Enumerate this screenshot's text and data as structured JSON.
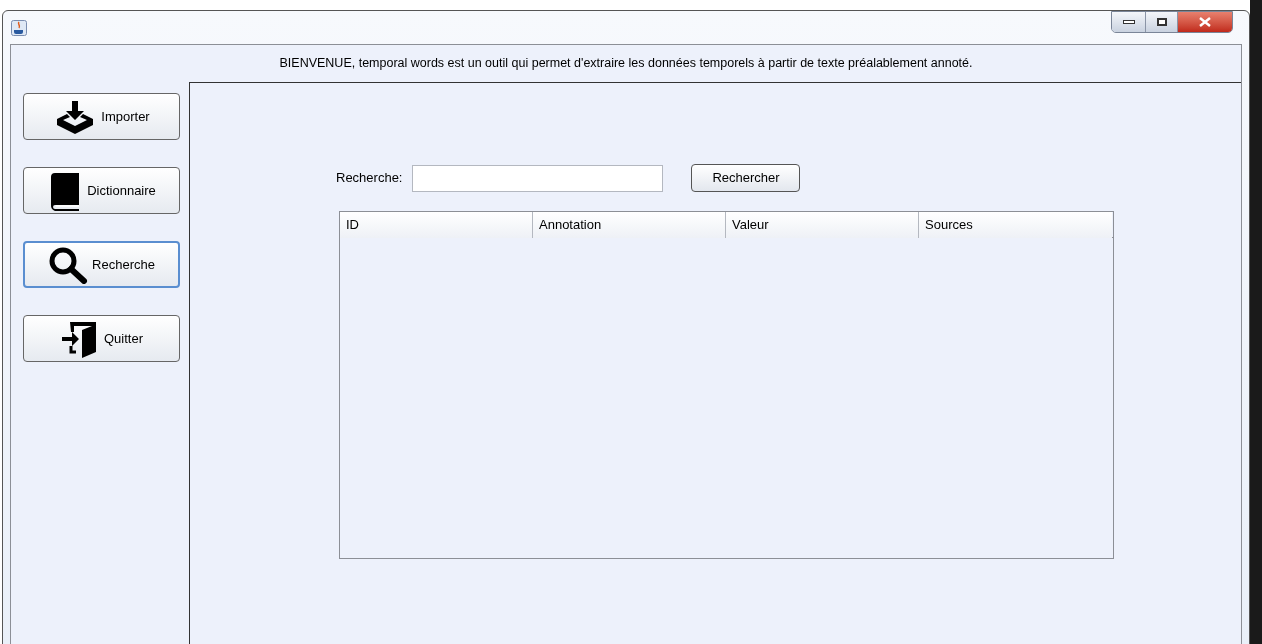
{
  "welcome": "BIENVENUE, temporal words est un outil qui permet d'extraire les données temporels à partir de texte préalablement annoté.",
  "sidebar": {
    "items": [
      {
        "label": "Importer",
        "selected": false
      },
      {
        "label": "Dictionnaire",
        "selected": false
      },
      {
        "label": "Recherche",
        "selected": true
      },
      {
        "label": "Quitter",
        "selected": false
      }
    ]
  },
  "search": {
    "label": "Recherche:",
    "button": "Rechercher"
  },
  "table": {
    "columns": [
      "ID",
      "Annotation",
      "Valeur",
      "Sources"
    ]
  }
}
